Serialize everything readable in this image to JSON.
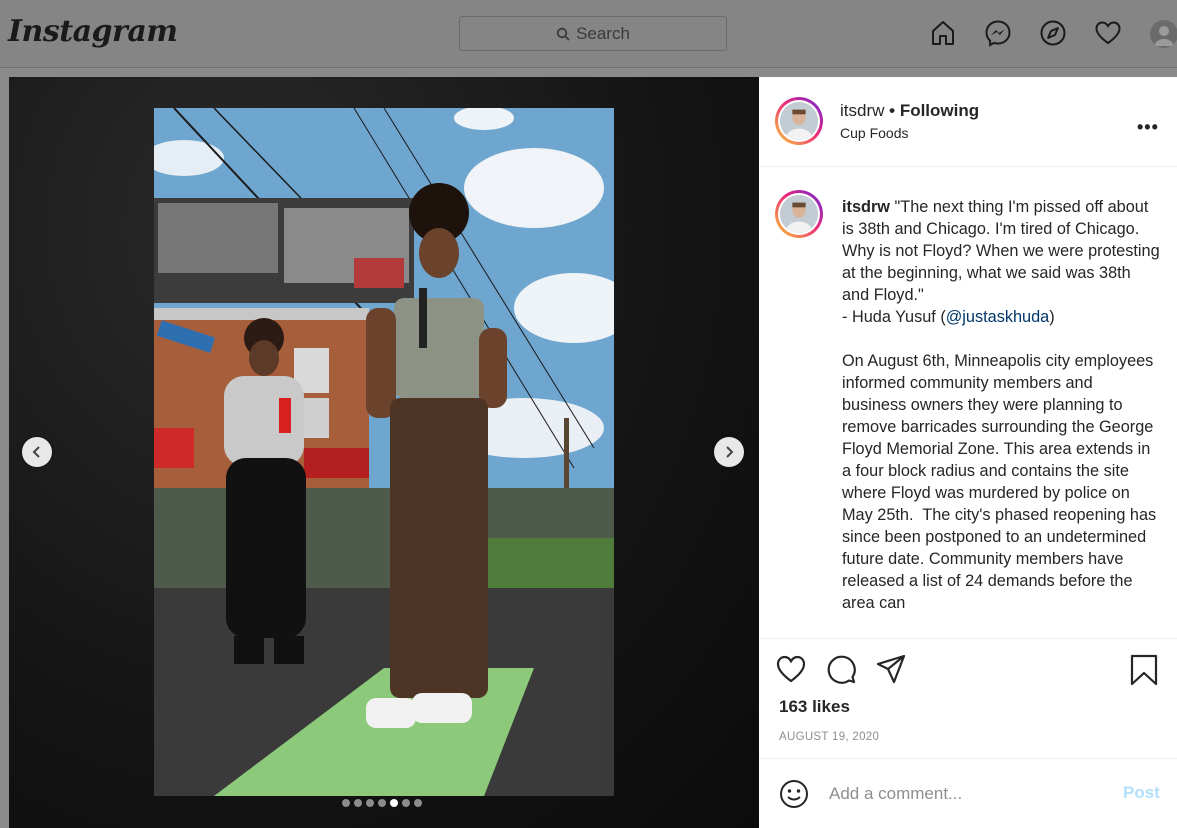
{
  "nav": {
    "logo": "Instagram",
    "search_placeholder": "Search",
    "icons": [
      "home-icon",
      "messenger-icon",
      "explore-icon",
      "heart-icon",
      "profile-avatar"
    ]
  },
  "media": {
    "slide_count": 7,
    "active_slide": 5
  },
  "post": {
    "username": "itsdrw",
    "following_label": "• Following",
    "location": "Cup Foods",
    "more_label": "•••"
  },
  "caption": {
    "username": "itsdrw",
    "text_before": " \"The next thing I'm pissed off about is 38th and Chicago. I'm tired of Chicago. Why is not Floyd? When we were protesting at the beginning, what we said was 38th and Floyd.\"\n- Huda Yusuf (",
    "mention": "@justaskhuda",
    "text_after": ")\n\nOn August 6th, Minneapolis city employees informed community members and business owners they were planning to remove barricades surrounding the George Floyd Memorial Zone. This area extends in a four block radius and contains the site where Floyd was murdered by police on May 25th.  The city's phased reopening has since been postponed to an undetermined future date. Community members have released a list of 24 demands before the area can"
  },
  "actions": {
    "likes": "163 likes",
    "date": "AUGUST 19, 2020"
  },
  "comment": {
    "placeholder": "Add a comment...",
    "post_label": "Post"
  },
  "colors": {
    "accent_link": "#00376b",
    "post_button_disabled": "#b2dffc",
    "story_ring_start": "#f9ce34",
    "story_ring_end": "#6228d7"
  }
}
